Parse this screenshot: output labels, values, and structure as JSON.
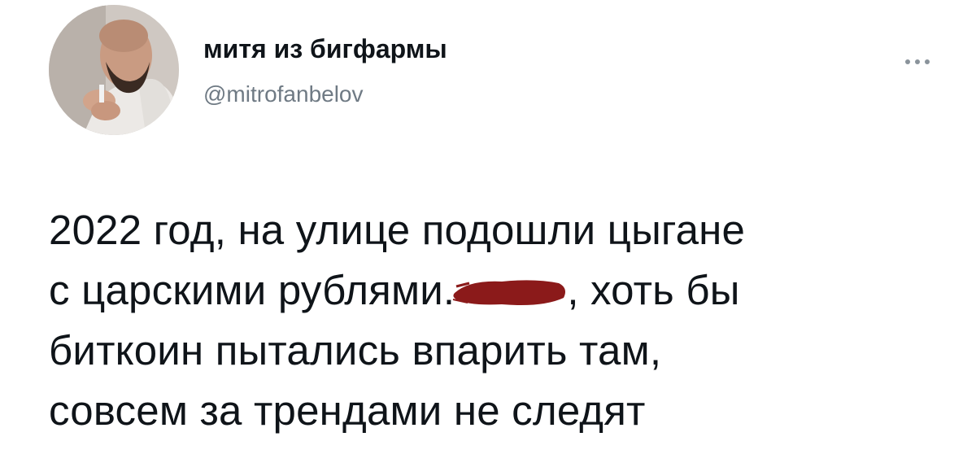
{
  "author": {
    "name": "митя из бигфармы",
    "handle": "@mitrofanbelov",
    "avatar_icon": "profile-photo-icon"
  },
  "actions": {
    "more_icon": "more-horizontal-icon"
  },
  "tweet": {
    "line1": "2022 год, на улице подошли цыгане",
    "line2_before": "с царскими рублями.",
    "line2_after": ", хоть бы",
    "line3": "биткоин пытались впарить там,",
    "line4": "совсем за трендами не следят",
    "redaction_color": "#8b1a1a"
  }
}
